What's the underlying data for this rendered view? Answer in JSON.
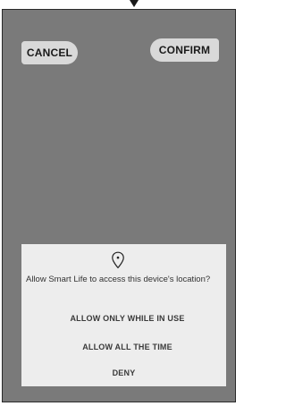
{
  "top_bar": {
    "cancel_label": "CANCEL",
    "confirm_label": "CONFIRM"
  },
  "permission_dialog": {
    "icon": "location-pin-icon",
    "message": "Allow Smart Life to access this device's location?",
    "options": [
      {
        "label": "ALLOW  ONLY WHILE IN USE"
      },
      {
        "label": "ALLOW  ALL THE TIME"
      },
      {
        "label": "DENY"
      }
    ]
  },
  "colors": {
    "screen_background": "#7a7a7a",
    "button_background": "#d9d9d9",
    "dialog_background": "#ededed"
  }
}
